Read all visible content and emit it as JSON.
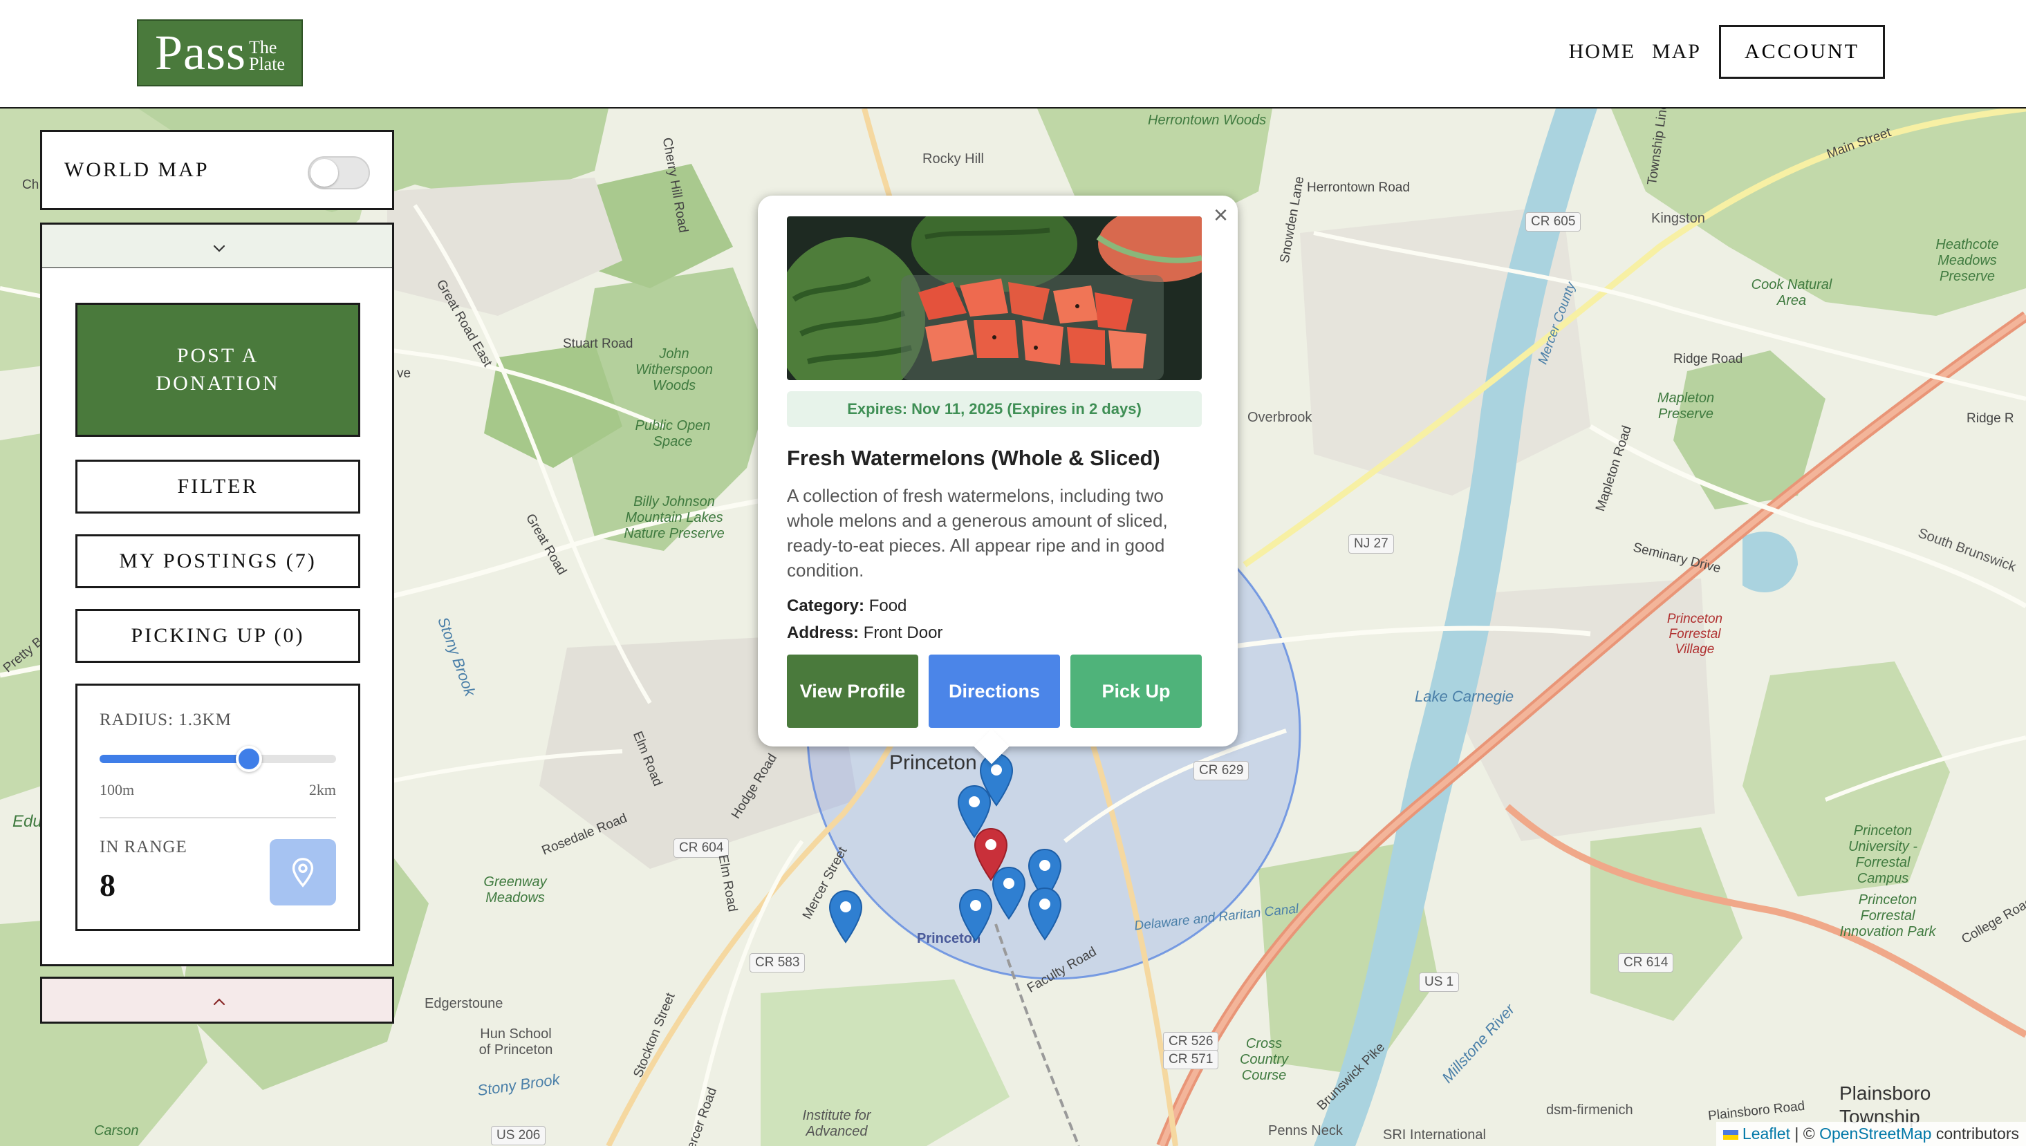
{
  "header": {
    "logo": {
      "main": "Pass",
      "the": "The",
      "plate": "Plate"
    },
    "nav": {
      "home": "HOME",
      "map": "MAP",
      "account": "ACCOUNT"
    }
  },
  "sidebar": {
    "world_map_label": "WORLD MAP",
    "world_map_enabled": false,
    "post_donation": "POST A DONATION",
    "filter": "FILTER",
    "my_postings": "MY POSTINGS (7)",
    "picking_up": "PICKING UP (0)",
    "radius_label": "RADIUS: 1.3KM",
    "radius_km": 1.3,
    "radius_min_label": "100m",
    "radius_max_label": "2km",
    "radius_min_km": 0.1,
    "radius_max_km": 2.0,
    "in_range_label": "IN RANGE",
    "in_range_value": "8"
  },
  "popup": {
    "expires": "Expires: Nov 11, 2025 (Expires in 2 days)",
    "title": "Fresh Watermelons (Whole & Sliced)",
    "description": "A collection of fresh watermelons, including two whole melons and a generous amount of sliced, ready-to-eat pieces. All appear ripe and in good condition.",
    "category_label": "Category:",
    "category_value": "Food",
    "address_label": "Address:",
    "address_value": "Front Door",
    "close": "×",
    "buttons": {
      "view_profile": "View Profile",
      "directions": "Directions",
      "pick_up": "Pick Up"
    }
  },
  "map": {
    "labels": {
      "herrontown_woods": "Herrontown Woods",
      "herrontown_road": "Herrontown Road",
      "rocky_hill": "Rocky Hill",
      "kingston": "Kingston",
      "cr605": "CR 605",
      "main_street": "Main Street",
      "heathcote": "Heathcote Meadows Preserve",
      "cook_natural": "Cook Natural Area",
      "ridge_road": "Ridge Road",
      "ridge_road_2": "Ridge R",
      "stuart_road": "Stuart Road",
      "john_witherspoon": "John Witherspoon Woods",
      "public_open_space": "Public Open Space",
      "great_road_east": "Great Road East",
      "overbrook": "Overbrook",
      "mapleton_preserve": "Mapleton Preserve",
      "mapleton_road": "Mapleton Road",
      "nj27": "NJ 27",
      "seminary_drive": "Seminary Drive",
      "south_brunswick": "South Brunswick",
      "billy_johnson": "Billy Johnson Mountain Lakes Nature Preserve",
      "great_road": "Great Road",
      "stony_brook": "Stony Brook",
      "lake_carnegie": "Lake Carnegie",
      "princeton_forrestal_village": "Princeton Forrestal Village",
      "princeton": "Princeton",
      "princeton_small": "Princeton",
      "cr629": "CR 629",
      "cr604": "CR 604",
      "elm_road": "Elm Road",
      "elm_road_2": "Elm Road",
      "hodge_road": "Hodge Road",
      "rosedale_road": "Rosedale Road",
      "mercer_street": "Mercer Street",
      "greenway_meadows": "Greenway Meadows",
      "princeton_university_forrestal": "Princeton University - Forrestal Campus",
      "princeton_forrestal_innovation": "Princeton Forrestal Innovation Park",
      "college_road": "College Road E",
      "cr583": "CR 583",
      "cr614": "CR 614",
      "us1": "US 1",
      "delaware_raritan": "Delaware and Raritan Canal",
      "faculty_road": "Faculty Road",
      "edgerstoune": "Edgerstoune",
      "hun_school": "Hun School of Princeton",
      "stony_brook_2": "Stony Brook",
      "stockton_street": "Stockton Street",
      "cr526": "CR 526",
      "cr571": "CR 571",
      "cross_country": "Cross Country Course",
      "brunswick_pike": "Brunswick Pike",
      "millstone_river": "Millstone River",
      "plainsboro_road": "Plainsboro Road",
      "plainsboro": "Plainsboro Township",
      "dsm": "dsm-firmenich",
      "sri": "SRI International",
      "penns_neck": "Penns Neck",
      "institute": "Institute for Advanced",
      "us206": "US 206",
      "carson": "Carson",
      "mercer_road": "Mercer Road",
      "cherry_hill": "Cherry Hill Road",
      "snowden_lane": "Snowden Lane",
      "mercer_county": "Mercer County",
      "township_line": "Township Line",
      "edu": "Edu",
      "pretty": "Pretty B",
      "ve": "ve",
      "ch": "Ch"
    },
    "attribution": {
      "leaflet": "Leaflet",
      "sep": "| ©",
      "osm": "OpenStreetMap",
      "contrib": "contributors"
    }
  },
  "colors": {
    "brand_green": "#4a7a3c",
    "directions_blue": "#4b85e8",
    "pickup_green": "#4fb37a",
    "marker_blue": "#2f7fd1",
    "marker_red": "#c9303a",
    "radius_fill": "#6f95f0"
  }
}
